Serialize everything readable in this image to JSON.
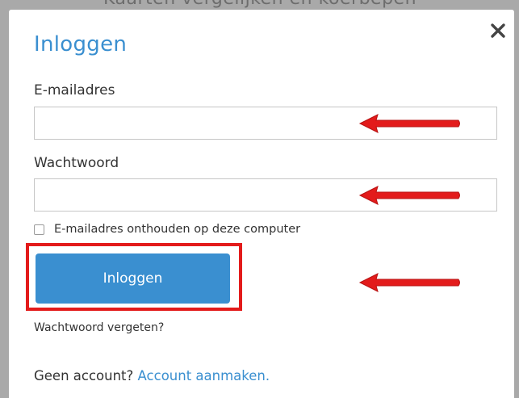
{
  "backdrop": {
    "text": "Kaarten vergelijken en koerbepen"
  },
  "modal": {
    "title": "Inloggen",
    "close_icon": "close-icon",
    "email": {
      "label": "E-mailadres",
      "value": "",
      "placeholder": ""
    },
    "password": {
      "label": "Wachtwoord",
      "value": "",
      "placeholder": ""
    },
    "remember": {
      "label": "E-mailadres onthouden op deze computer",
      "checked": false
    },
    "login_button": "Inloggen",
    "forgot_link": "Wachtwoord vergeten?",
    "footer": {
      "text": "Geen account?",
      "link": "Account aanmaken."
    }
  },
  "annotations": {
    "arrow_color": "#e31b1b",
    "highlight_color": "#e31b1b",
    "arrow_icons": [
      "red-arrow-icon",
      "red-arrow-icon",
      "red-arrow-icon"
    ]
  },
  "colors": {
    "accent": "#3a8fd0",
    "text": "#333333",
    "backdrop": "#a9a9a9"
  }
}
